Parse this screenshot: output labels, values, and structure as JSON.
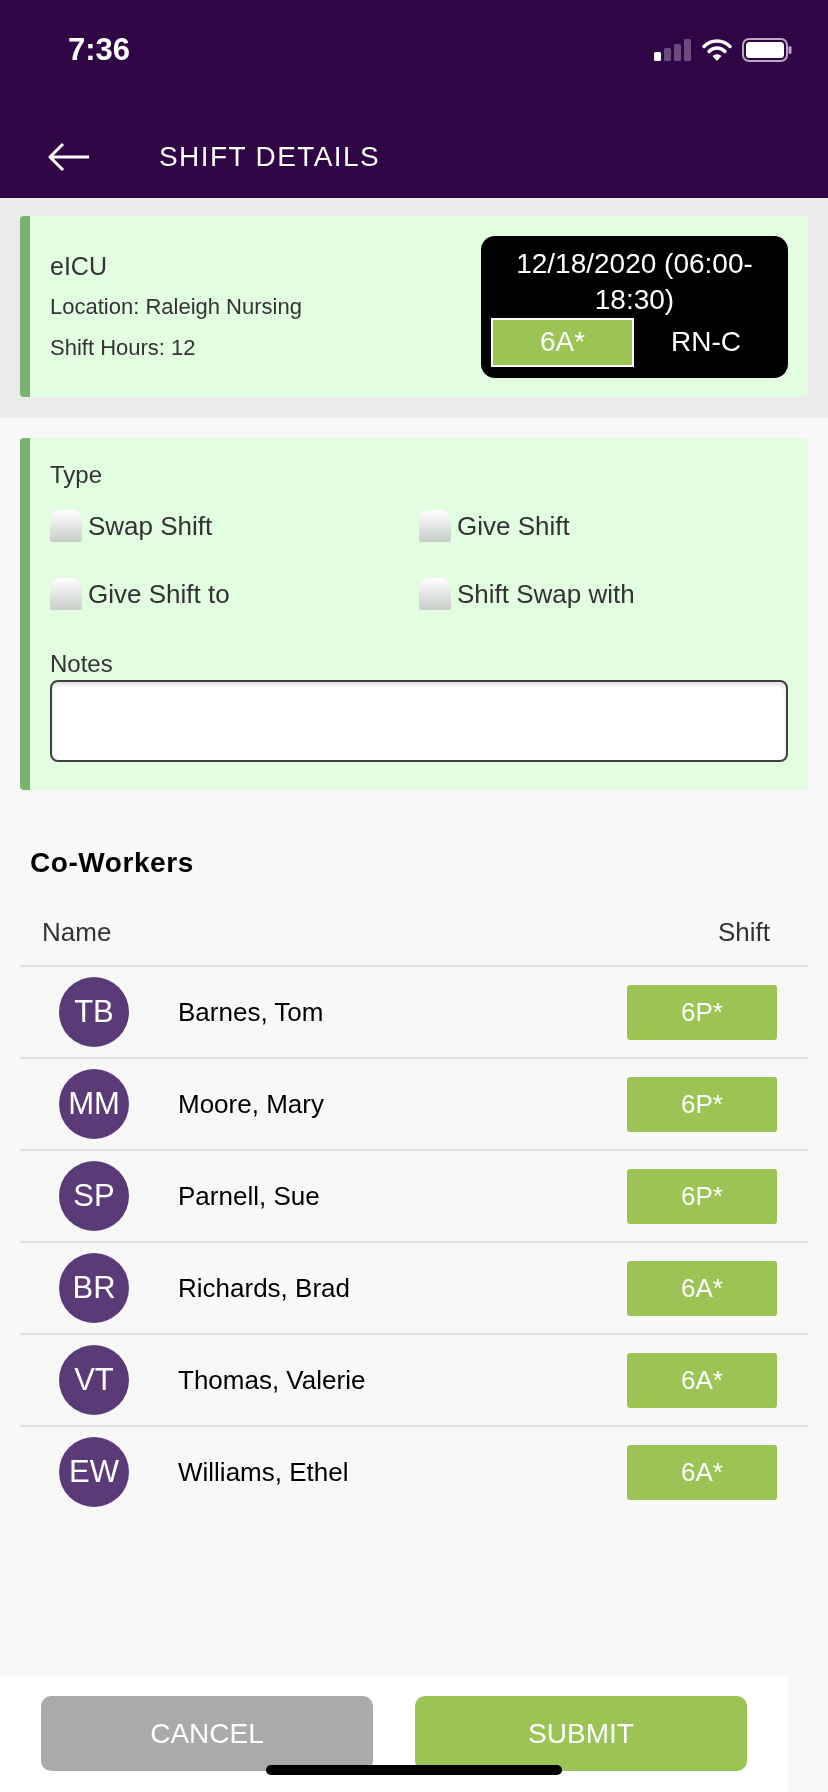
{
  "status_bar": {
    "time": "7:36"
  },
  "header": {
    "title": "SHIFT DETAILS"
  },
  "shift": {
    "unit": "eICU",
    "location": "Location: Raleigh Nursing",
    "hours": "Shift Hours: 12",
    "datetime": "12/18/2020 (06:00-18:30)",
    "code": "6A*",
    "role": "RN-C"
  },
  "request": {
    "type_label": "Type",
    "options": [
      {
        "label": "Swap Shift",
        "checked": false
      },
      {
        "label": "Give Shift",
        "checked": false
      },
      {
        "label": "Give Shift to",
        "checked": false
      },
      {
        "label": "Shift Swap with",
        "checked": false
      }
    ],
    "notes_label": "Notes"
  },
  "coworkers": {
    "title": "Co-Workers",
    "columns": [
      "Name",
      "Shift"
    ],
    "rows": [
      {
        "initials": "TB",
        "name": "Barnes, Tom",
        "shift": "6P*"
      },
      {
        "initials": "MM",
        "name": "Moore, Mary",
        "shift": "6P*"
      },
      {
        "initials": "SP",
        "name": "Parnell, Sue",
        "shift": "6P*"
      },
      {
        "initials": "BR",
        "name": "Richards, Brad",
        "shift": "6A*"
      },
      {
        "initials": "VT",
        "name": "Thomas, Valerie",
        "shift": "6A*"
      },
      {
        "initials": "EW",
        "name": "Williams, Ethel",
        "shift": "6A*"
      }
    ]
  },
  "buttons": [
    {
      "label": "CANCEL",
      "kind": "cancel"
    },
    {
      "label": "SUBMIT",
      "kind": "submit"
    }
  ]
}
